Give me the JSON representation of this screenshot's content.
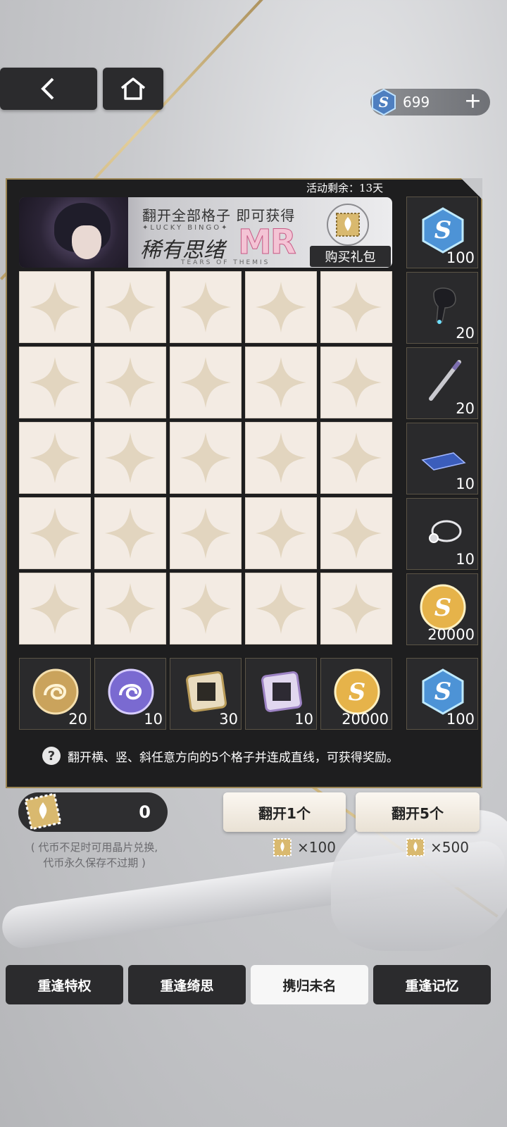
{
  "header": {
    "back_icon": "chevron-left-icon",
    "home_icon": "home-icon",
    "currency": {
      "icon": "s-crystal-icon",
      "value": "699",
      "add": "+"
    }
  },
  "event": {
    "timer_label": "活动剩余：13天",
    "banner": {
      "title": "翻开全部格子 即可获得",
      "lucky": "✦LUCKY BINGO✦",
      "rare": "稀有思绪",
      "mr": "MR",
      "subtitle": "TEARS OF THEMIS",
      "buy_pack": "购买礼包"
    }
  },
  "grid": {
    "rows": 5,
    "cols": 5,
    "cell_icon": "sparkle-icon"
  },
  "side_rewards": [
    {
      "icon": "s-crystal-icon",
      "count": "100"
    },
    {
      "icon": "earbud-icon",
      "count": "20"
    },
    {
      "icon": "pen-icon",
      "count": "20"
    },
    {
      "icon": "tablet-icon",
      "count": "10"
    },
    {
      "icon": "stethoscope-icon",
      "count": "10"
    },
    {
      "icon": "gold-coin-icon",
      "count": "20000"
    }
  ],
  "bottom_rewards": [
    {
      "icon": "gold-dragon-medal-icon",
      "count": "20"
    },
    {
      "icon": "purple-dragon-medal-icon",
      "count": "10"
    },
    {
      "icon": "gold-chip-icon",
      "count": "30"
    },
    {
      "icon": "purple-chip-icon",
      "count": "10"
    },
    {
      "icon": "gold-coin-icon",
      "count": "20000"
    }
  ],
  "corner_reward": {
    "icon": "s-crystal-icon",
    "count": "100"
  },
  "rule_text": "翻开横、竖、斜任意方向的5个格子并连成直线，可获得奖励。",
  "token": {
    "value": "0",
    "note_line1": "( 代币不足时可用晶片兑换,",
    "note_line2": "代币永久保存不过期 )"
  },
  "actions": {
    "flip1": "翻开1个",
    "flip1_cost": "×100",
    "flip5": "翻开5个",
    "flip5_cost": "×500"
  },
  "tabs": [
    {
      "label": "重逢特权",
      "active": false
    },
    {
      "label": "重逢绮思",
      "active": false
    },
    {
      "label": "携归未名",
      "active": true
    },
    {
      "label": "重逢记忆",
      "active": false
    }
  ],
  "colors": {
    "panel": "#1e1e1f",
    "gold": "#c9ac6b",
    "cell": "#f3ebe3"
  }
}
